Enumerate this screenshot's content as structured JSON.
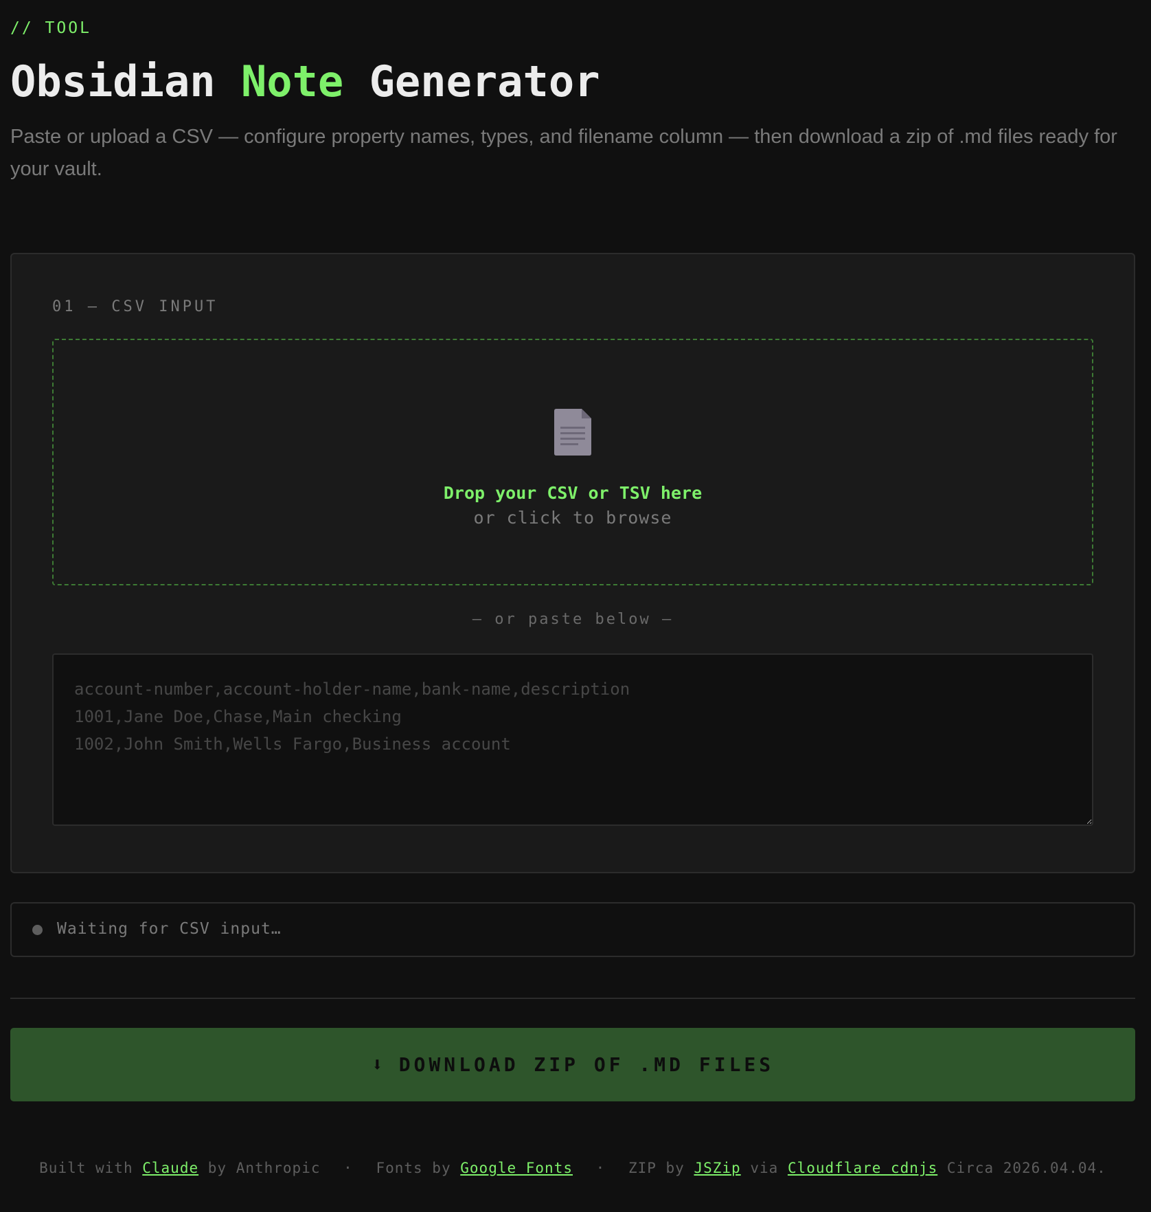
{
  "header": {
    "eyebrow": "// TOOL",
    "title_part1": "Obsidian ",
    "title_accent": "Note",
    "title_part2": " Generator",
    "subtitle": "Paste or upload a CSV — configure property names, types, and filename column — then download a zip of .md files ready for your vault."
  },
  "csv_input": {
    "section_label": "01 — CSV INPUT",
    "drop_main": "Drop your CSV or TSV here",
    "drop_sub": "or click to browse",
    "file_icon": "document-icon",
    "or_paste": "— or paste below —",
    "placeholder": "account-number,account-holder-name,bank-name,description\n1001,Jane Doe,Chase,Main checking\n1002,John Smith,Wells Fargo,Business account",
    "value": ""
  },
  "status": {
    "text": "Waiting for CSV input…"
  },
  "download": {
    "icon": "⬇",
    "label": "DOWNLOAD ZIP OF .MD FILES"
  },
  "footer": {
    "built_with": "Built with",
    "claude_link": "Claude",
    "by_anthropic": "by Anthropic",
    "sep": "·",
    "fonts_by": "Fonts by",
    "google_fonts_link": "Google Fonts",
    "zip_by": "ZIP by",
    "jszip_link": "JSZip",
    "via": "via",
    "cdnjs_link": "Cloudflare cdnjs",
    "circa": "Circa 2026.04.04."
  },
  "colors": {
    "background": "#101010",
    "card": "#1a1a1a",
    "accent": "#7ef06a",
    "button": "#2e552b",
    "muted": "#7a7a7a"
  }
}
